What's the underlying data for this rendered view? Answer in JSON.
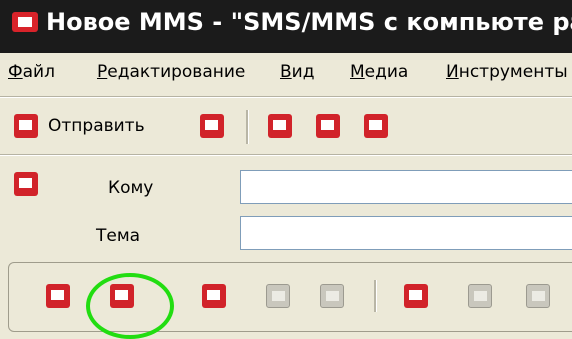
{
  "window": {
    "title": "Новое MMS - \"SMS/MMS с компьюте ра\"",
    "app_icon": "mail-envelope-icon"
  },
  "menu": {
    "items": [
      "Файл",
      "Редактирование",
      "Вид",
      "Медиа",
      "Инструменты"
    ]
  },
  "toolbar": {
    "send_label": "Отправить",
    "icons": [
      "send-icon",
      "contacts-icon",
      "attach-icon",
      "mailbox-icon",
      "settings-icon"
    ]
  },
  "form": {
    "to_label": "Кому",
    "subject_label": "Тема",
    "to_value": "",
    "subject_value": ""
  },
  "slides_toolbar": {
    "icons": [
      "add-slide-icon",
      "delete-slide-icon",
      "insert-frame-icon",
      "remove-frame-icon",
      "frame-icon",
      "add-audio-icon",
      "remove-audio-icon",
      "audio-icon"
    ]
  },
  "colors": {
    "accent": "#d1232a",
    "titlebar": "#1b1b1b",
    "highlight": "#22dd11"
  }
}
